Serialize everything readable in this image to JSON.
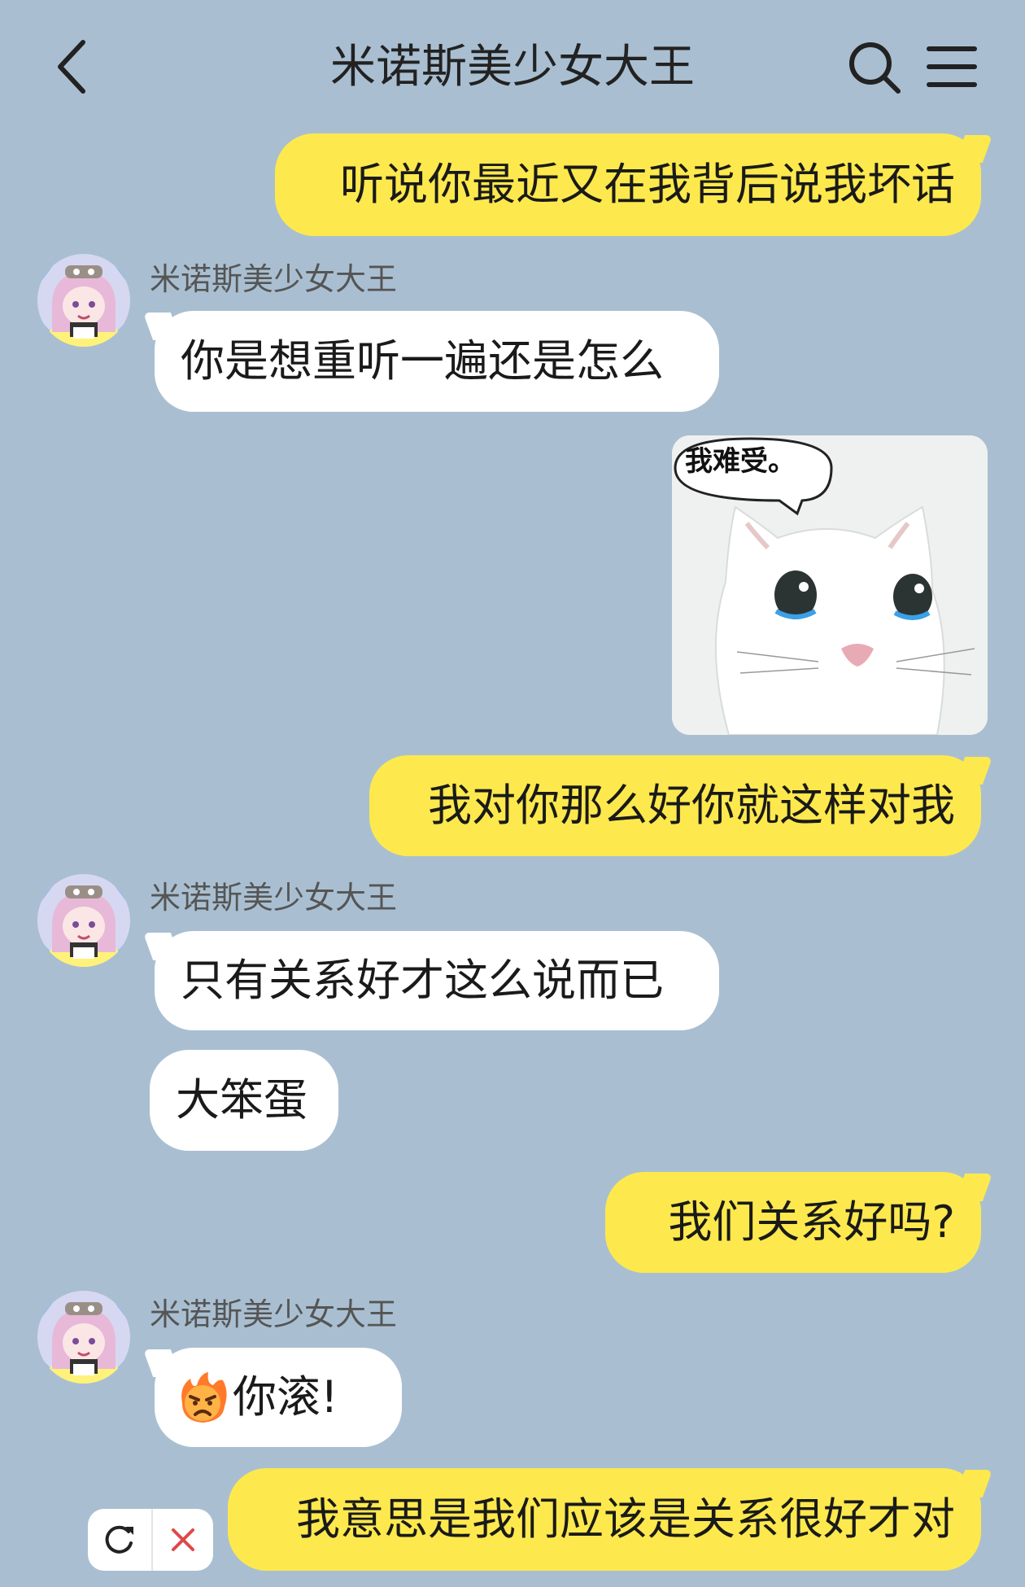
{
  "header": {
    "title": "米诺斯美少女大王",
    "back_icon": "chevron-left-icon",
    "search_icon": "search-icon",
    "menu_icon": "menu-icon"
  },
  "contact": {
    "name": "米诺斯美少女大王",
    "avatar_icon": "anime-girl-avatar"
  },
  "messages": [
    {
      "side": "out",
      "text": "听说你最近又在我背后说我坏话"
    },
    {
      "side": "in",
      "sender": "米诺斯美少女大王",
      "text": "你是想重听一遍还是怎么"
    },
    {
      "side": "out",
      "type": "sticker",
      "caption": "我难受。",
      "icon": "crying-cat-sticker"
    },
    {
      "side": "out",
      "text": "我对你那么好你就这样对我"
    },
    {
      "side": "in",
      "sender": "米诺斯美少女大王",
      "text": "只有关系好才这么说而已"
    },
    {
      "side": "in",
      "text": "大笨蛋"
    },
    {
      "side": "out",
      "text": "我们关系好吗?"
    },
    {
      "side": "in",
      "sender": "米诺斯美少女大王",
      "emoji": "angry-face-emoji",
      "text": "你滚!"
    },
    {
      "side": "out",
      "text": "我意思是我们应该是关系很好才对",
      "status": "failed"
    }
  ],
  "retry_panel": {
    "retry_icon": "retry-icon",
    "cancel_icon": "close-icon"
  },
  "colors": {
    "background": "#a9bfd1",
    "outgoing_bubble": "#fde94d",
    "incoming_bubble": "#ffffff",
    "cancel": "#e04848"
  }
}
